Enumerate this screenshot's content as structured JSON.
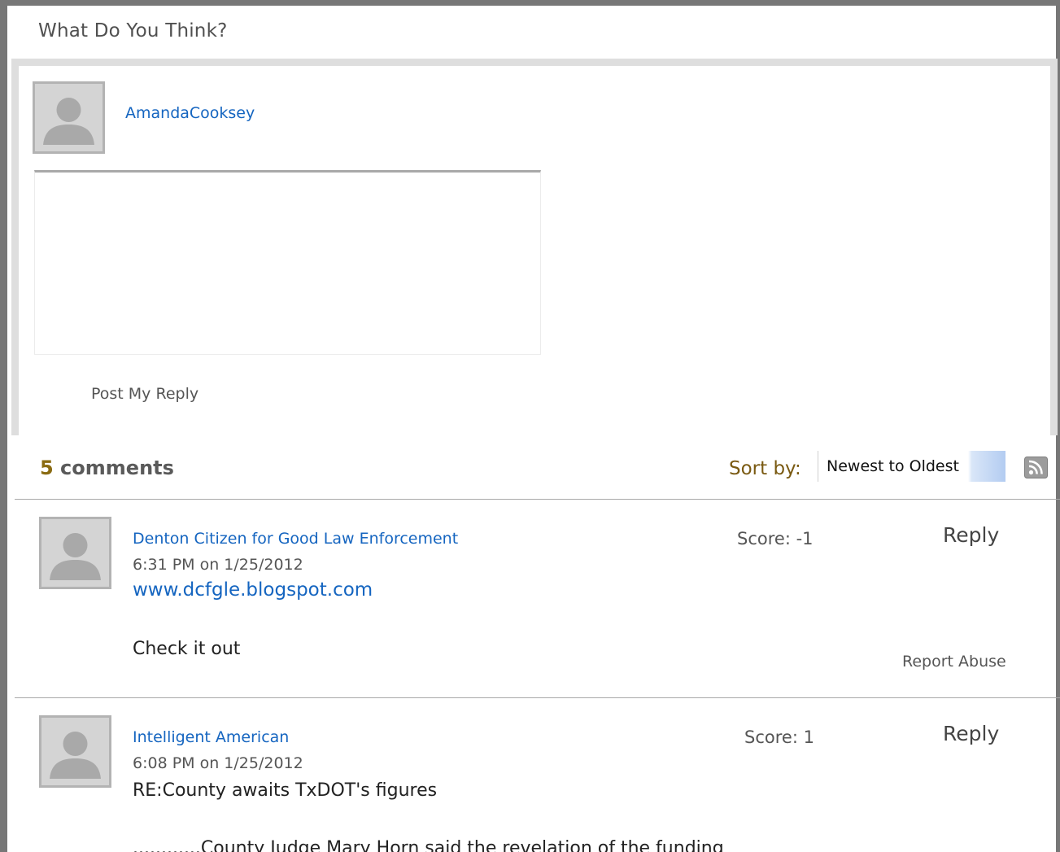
{
  "section": {
    "title": "What Do You Think?"
  },
  "compose": {
    "username": "AmandaCooksey",
    "reply_text": "",
    "post_label": "Post My Reply",
    "avatar_icon": "default-user-avatar-icon"
  },
  "comments_header": {
    "count_number": "5",
    "count_label": " comments",
    "sort_label": "Sort by:",
    "sort_value": "Newest to Oldest",
    "rss_icon": "rss-feed-icon"
  },
  "comments": [
    {
      "author": "Denton Citizen for Good Law Enforcement",
      "time": "6:31 PM on 1/25/2012",
      "score": "Score: -1",
      "reply_label": "Reply",
      "link": "www.dcfgle.blogspot.com",
      "text": "Check it out",
      "report_label": "Report Abuse"
    },
    {
      "author": "Intelligent American",
      "time": "6:08 PM on 1/25/2012",
      "score": "Score: 1",
      "reply_label": "Reply",
      "subject": "RE:County awaits TxDOT's figures",
      "text": "............County Judge Mary Horn said the revelation of the funding"
    }
  ],
  "colors": {
    "link": "#1565c0",
    "frame": "#777777",
    "count_accent": "#8a6b12",
    "sort_label": "#7a5a12"
  }
}
